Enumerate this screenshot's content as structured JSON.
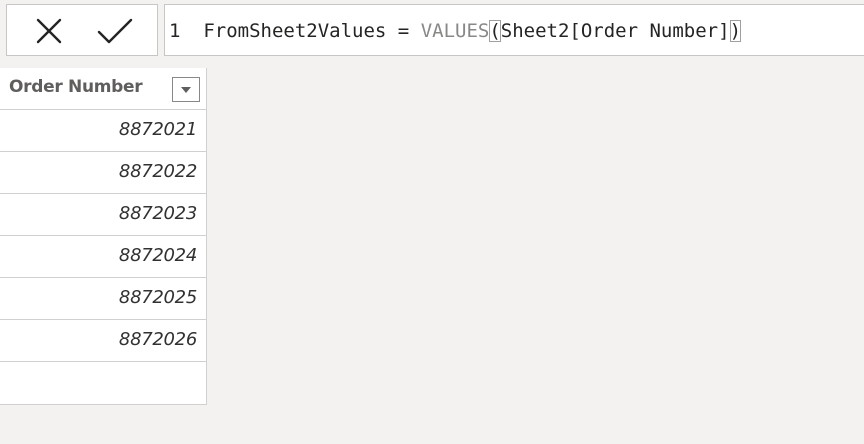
{
  "formula_bar": {
    "cancel_icon": "close-x-icon",
    "commit_icon": "checkmark-icon",
    "line_number": "1",
    "measure_name": "FromSheet2Values = ",
    "function_name": "VALUES",
    "open_paren": "(",
    "argument": "Sheet2[Order Number]",
    "close_paren": ")"
  },
  "table": {
    "column_header": "Order Number",
    "filter_icon": "dropdown-arrow-icon",
    "rows": [
      "8872021",
      "8872022",
      "8872023",
      "8872024",
      "8872025",
      "8872026"
    ]
  },
  "colors": {
    "background": "#f3f2f1",
    "function_text": "#8a8886",
    "header_text": "#605e5c",
    "grid_line": "#d2d0ce"
  }
}
